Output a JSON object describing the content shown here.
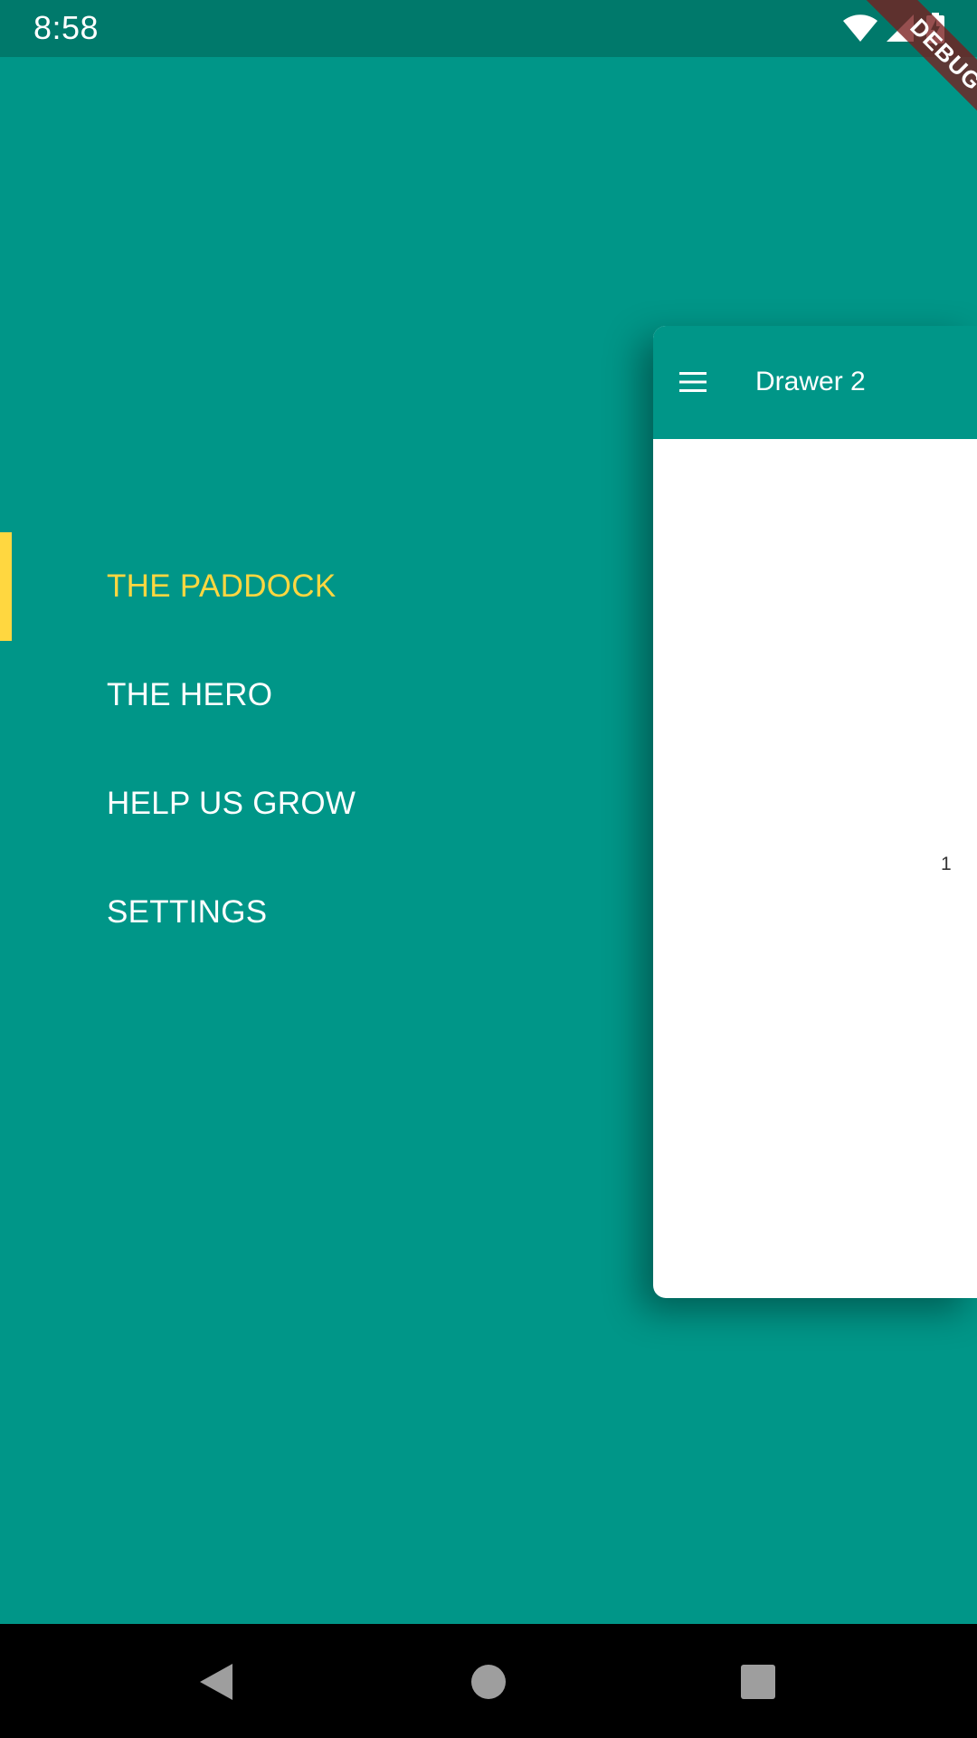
{
  "status_bar": {
    "time": "8:58",
    "icons": [
      "wifi-icon",
      "signal-icon",
      "battery-charging-icon"
    ]
  },
  "debug_banner": {
    "label": "DEBUG"
  },
  "drawer": {
    "items": [
      {
        "label": "THE PADDOCK",
        "active": true
      },
      {
        "label": "THE HERO",
        "active": false
      },
      {
        "label": "HELP US GROW",
        "active": false
      },
      {
        "label": "SETTINGS",
        "active": false
      }
    ]
  },
  "content_card": {
    "title": "Drawer 2",
    "menu_icon": "hamburger-menu-icon",
    "page_number": "1"
  },
  "nav_bar": {
    "buttons": [
      "back-icon",
      "home-icon",
      "recents-icon"
    ]
  },
  "colors": {
    "primary": "#009688",
    "status_bar": "#00796B",
    "accent": "#FFD740",
    "text_on_primary": "#FFFFFF",
    "nav_bar": "#000000",
    "debug_ribbon": "#781E1E"
  }
}
